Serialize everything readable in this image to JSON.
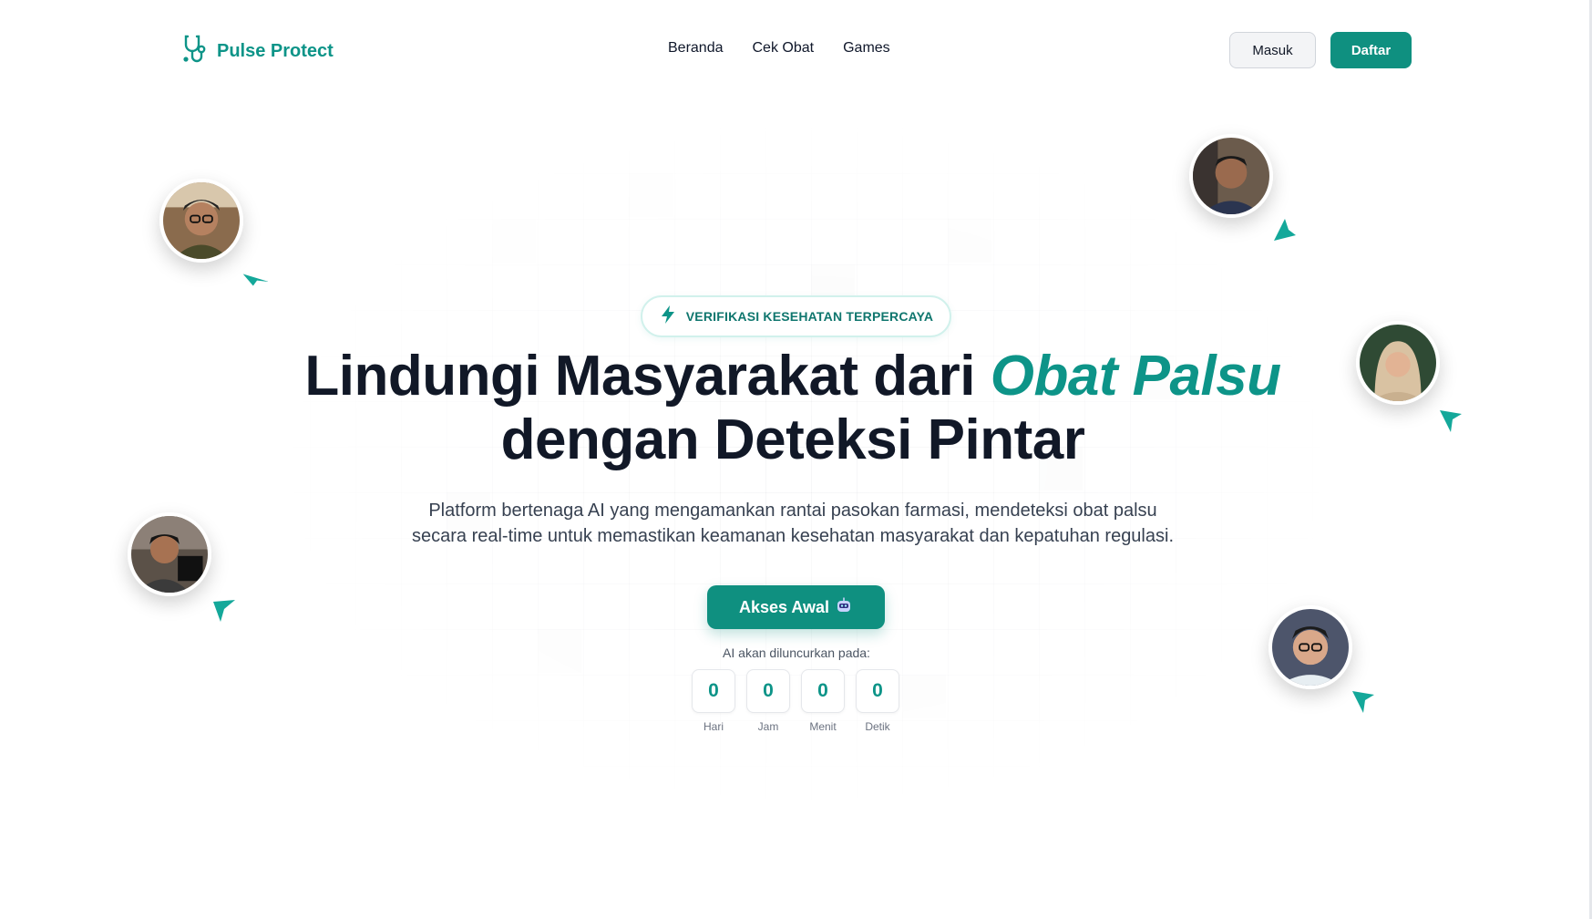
{
  "brand": {
    "name": "Pulse Protect",
    "icon": "stethoscope-icon",
    "color": "#0d9488"
  },
  "nav": {
    "items": [
      {
        "label": "Beranda"
      },
      {
        "label": "Cek Obat"
      },
      {
        "label": "Games"
      }
    ],
    "login_label": "Masuk",
    "register_label": "Daftar"
  },
  "hero": {
    "badge": {
      "icon": "lightning-bolt-icon",
      "text": "VERIFIKASI KESEHATAN TERPERCAYA"
    },
    "title_part1": "Lindungi Masyarakat dari ",
    "title_accent": "Obat Palsu",
    "title_part2": "dengan Deteksi Pintar",
    "subtitle_line1": "Platform bertenaga AI yang mengamankan rantai pasokan farmasi, mendeteksi obat palsu",
    "subtitle_line2": "secara real-time untuk memastikan keamanan kesehatan masyarakat dan kepatuhan regulasi.",
    "cta_label": "Akses Awal",
    "cta_icon": "robot-icon",
    "launch_label": "AI akan diluncurkan pada:",
    "countdown": [
      {
        "value": "0",
        "label": "Hari"
      },
      {
        "value": "0",
        "label": "Jam"
      },
      {
        "value": "0",
        "label": "Menit"
      },
      {
        "value": "0",
        "label": "Detik"
      }
    ]
  },
  "colors": {
    "primary": "#0f9080",
    "accent": "#0d9488",
    "text": "#111827"
  }
}
